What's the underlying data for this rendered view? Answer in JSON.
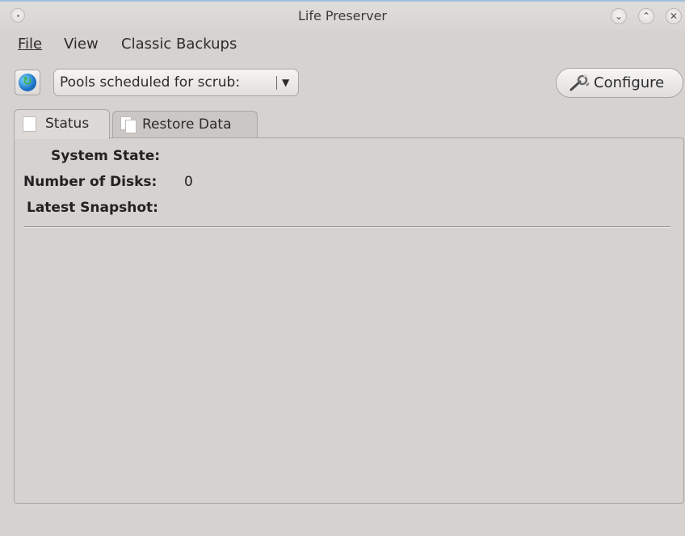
{
  "window": {
    "title": "Life Preserver",
    "controls": {
      "minimize_icon": "chevron-down-icon",
      "maximize_icon": "chevron-up-icon",
      "close_icon": "close-icon",
      "minimize_glyph": "⌄",
      "maximize_glyph": "⌃",
      "close_glyph": "✕"
    }
  },
  "menubar": {
    "file": "File",
    "view": "View",
    "classic_backups": "Classic Backups"
  },
  "toolbar": {
    "refresh_icon": "globe-refresh-icon",
    "pool_combo_value": "Pools scheduled for scrub:",
    "configure_label": "Configure",
    "configure_icon": "wrench-icon"
  },
  "tabs": [
    {
      "label": "Status",
      "active": true,
      "icon": "page-icon"
    },
    {
      "label": "Restore Data",
      "active": false,
      "icon": "documents-icon"
    }
  ],
  "status": {
    "system_state_label": "System State:",
    "system_state_value": "",
    "disks_label": "Number of Disks:",
    "disks_value": "0",
    "snapshot_label": "Latest Snapshot:",
    "snapshot_value": ""
  },
  "colors": {
    "window_bg": "#d6d2d0",
    "title_accent": "#9fc1dd"
  }
}
